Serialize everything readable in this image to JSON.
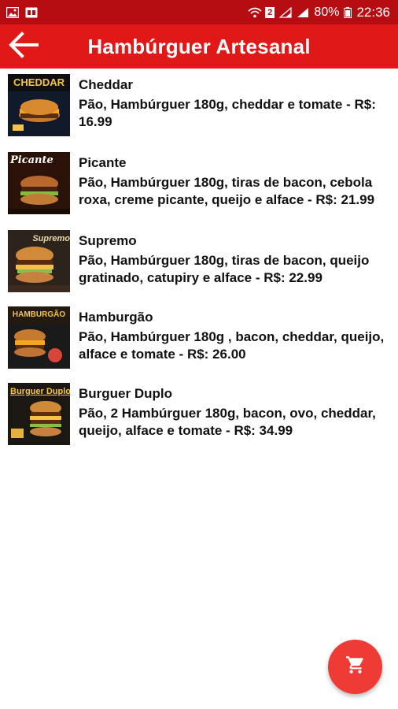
{
  "status_bar": {
    "battery_percent": "80%",
    "time": "22:36",
    "sim_badge": "2"
  },
  "app_bar": {
    "title": "Hambúrguer Artesanal",
    "back_icon": "arrow-left-icon"
  },
  "items": [
    {
      "name": "Cheddar",
      "description": "Pão, Hambúrguer 180g, cheddar e tomate - R$: 16.99",
      "thumb_label": "CHEDDAR"
    },
    {
      "name": "Picante",
      "description": "Pão, Hambúrguer 180g, tiras de bacon, cebola roxa, creme picante, queijo e alface - R$: 21.99",
      "thumb_label": "Picante"
    },
    {
      "name": "Supremo",
      "description": "Pão, Hambúrguer 180g, tiras de bacon, queijo gratinado, catupiry e alface - R$: 22.99",
      "thumb_label": "Supremo"
    },
    {
      "name": "Hamburgão",
      "description": "Pão, Hambúrguer 180g , bacon, cheddar, queijo, alface e tomate - R$: 26.00",
      "thumb_label": "HAMBURGÃO"
    },
    {
      "name": "Burguer Duplo",
      "description": "Pão, 2 Hambúrguer 180g, bacon, ovo, cheddar, queijo, alface e tomate - R$: 34.99",
      "thumb_label": "Burguer Duplo"
    }
  ],
  "fab": {
    "icon": "cart-icon"
  },
  "colors": {
    "status_bar": "#b50d12",
    "app_bar": "#e11818",
    "fab": "#ef3b35"
  }
}
